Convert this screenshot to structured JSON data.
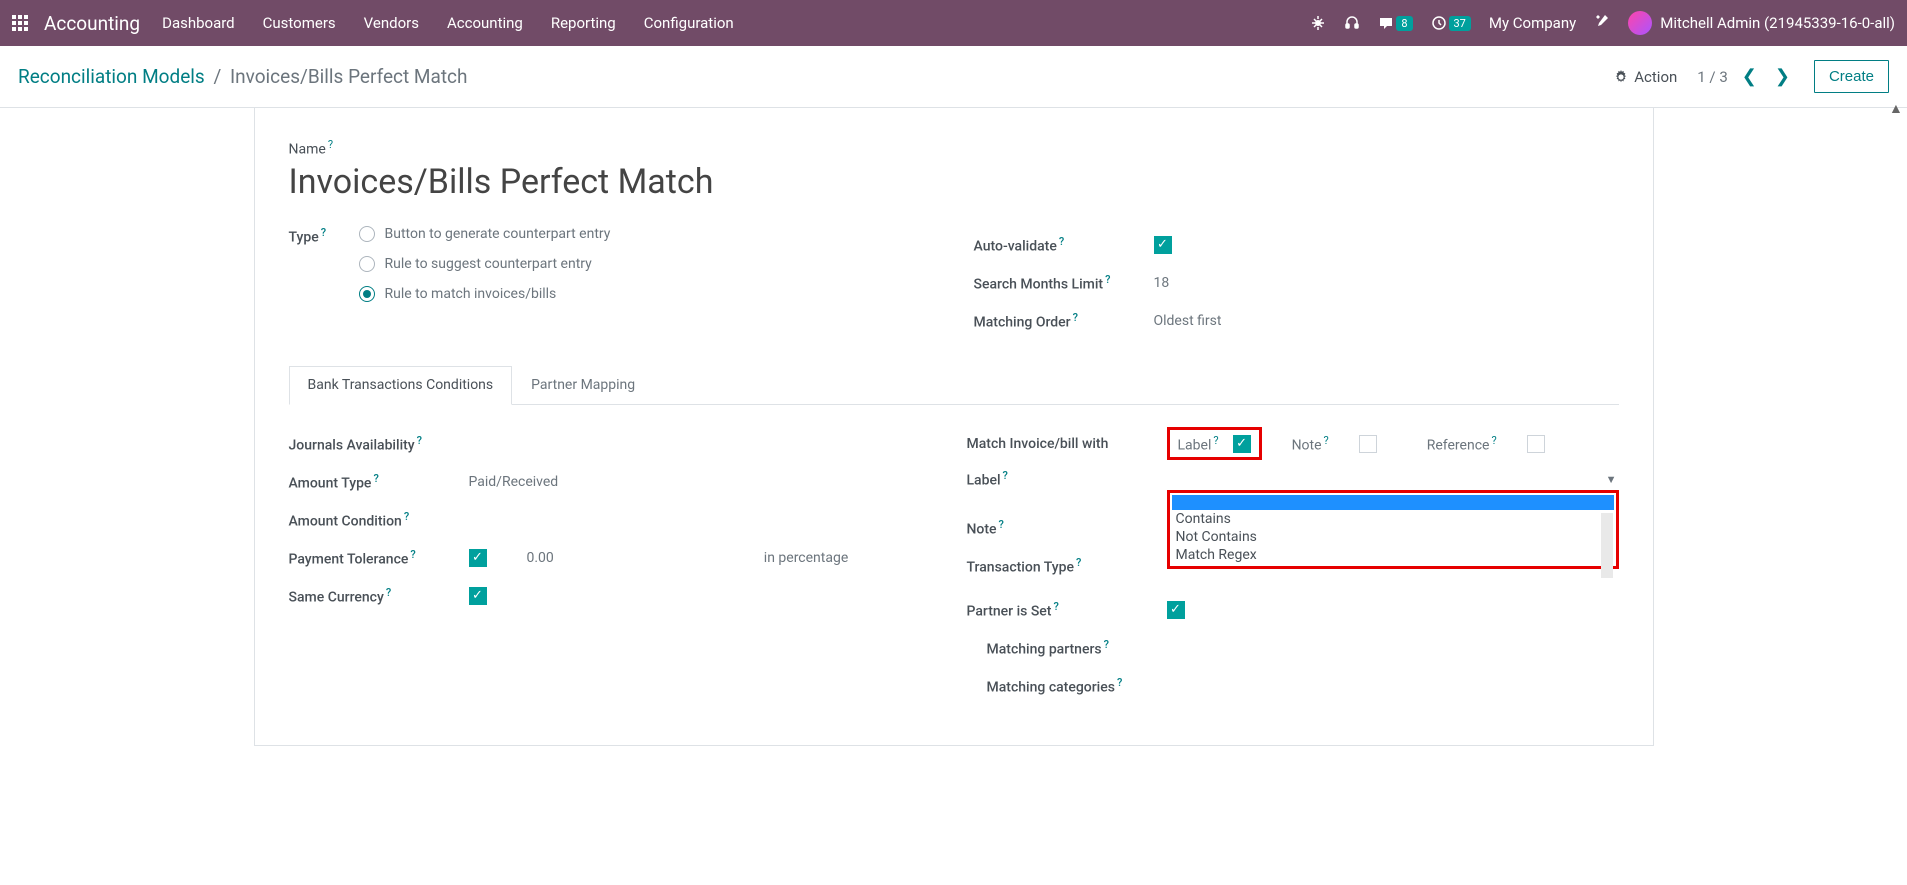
{
  "navbar": {
    "brand": "Accounting",
    "menu": [
      "Dashboard",
      "Customers",
      "Vendors",
      "Accounting",
      "Reporting",
      "Configuration"
    ],
    "chat_count": "8",
    "activity_count": "37",
    "company": "My Company",
    "user": "Mitchell Admin (21945339-16-0-all)"
  },
  "control_panel": {
    "breadcrumb_parent": "Reconciliation Models",
    "breadcrumb_current": "Invoices/Bills Perfect Match",
    "action_label": "Action",
    "pager": "1 / 3",
    "create_label": "Create"
  },
  "form": {
    "name_label": "Name",
    "name_value": "Invoices/Bills Perfect Match",
    "type_label": "Type",
    "type_options": [
      "Button to generate counterpart entry",
      "Rule to suggest counterpart entry",
      "Rule to match invoices/bills"
    ],
    "auto_validate_label": "Auto-validate",
    "search_months_label": "Search Months Limit",
    "search_months_value": "18",
    "matching_order_label": "Matching Order",
    "matching_order_value": "Oldest first"
  },
  "tabs": {
    "t1": "Bank Transactions Conditions",
    "t2": "Partner Mapping"
  },
  "left": {
    "journals_label": "Journals Availability",
    "amount_type_label": "Amount Type",
    "amount_type_value": "Paid/Received",
    "amount_condition_label": "Amount Condition",
    "payment_tolerance_label": "Payment Tolerance",
    "payment_tolerance_value": "0.00",
    "payment_tolerance_unit": "in percentage",
    "same_currency_label": "Same Currency"
  },
  "right": {
    "match_label": "Match Invoice/bill with",
    "match_opt_label": "Label",
    "match_opt_note": "Note",
    "match_opt_ref": "Reference",
    "label_label": "Label",
    "note_label": "Note",
    "transaction_type_label": "Transaction Type",
    "partner_set_label": "Partner is Set",
    "matching_partners_label": "Matching partners",
    "matching_categories_label": "Matching categories",
    "dropdown_options": [
      "Contains",
      "Not Contains",
      "Match Regex"
    ]
  }
}
